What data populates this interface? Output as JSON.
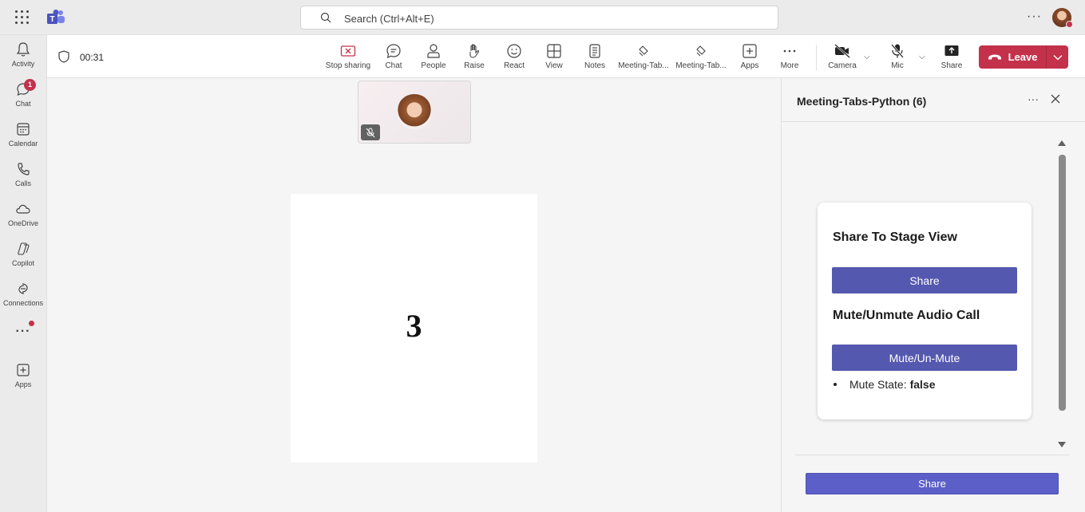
{
  "titlebar": {
    "search_placeholder": "Search (Ctrl+Alt+E)",
    "more": "···"
  },
  "rail": {
    "items": [
      {
        "label": "Activity",
        "icon": "bell-icon"
      },
      {
        "label": "Chat",
        "icon": "chat-icon",
        "badge": "1"
      },
      {
        "label": "Calendar",
        "icon": "calendar-icon"
      },
      {
        "label": "Calls",
        "icon": "phone-icon"
      },
      {
        "label": "OneDrive",
        "icon": "cloud-icon"
      },
      {
        "label": "Copilot",
        "icon": "copilot-icon"
      },
      {
        "label": "Connections",
        "icon": "connections-icon"
      },
      {
        "label": "···",
        "icon": "more-icon"
      },
      {
        "label": "Apps",
        "icon": "apps-icon"
      }
    ]
  },
  "meeting": {
    "timer": "00:31",
    "buttons": [
      {
        "label": "Stop sharing",
        "icon": "stop-sharing-icon"
      },
      {
        "label": "Chat",
        "icon": "chat-icon"
      },
      {
        "label": "People",
        "icon": "people-icon"
      },
      {
        "label": "Raise",
        "icon": "hand-icon"
      },
      {
        "label": "React",
        "icon": "smile-icon"
      },
      {
        "label": "View",
        "icon": "grid-icon"
      },
      {
        "label": "Notes",
        "icon": "notes-icon"
      },
      {
        "label": "Meeting-Tab...",
        "icon": "app-icon"
      },
      {
        "label": "Meeting-Tab...",
        "icon": "app-icon"
      },
      {
        "label": "Apps",
        "icon": "plus-icon"
      },
      {
        "label": "More",
        "icon": "more-icon"
      },
      {
        "label": "Camera",
        "icon": "camera-off-icon"
      },
      {
        "label": "Mic",
        "icon": "mic-off-icon"
      },
      {
        "label": "Share",
        "icon": "share-icon"
      }
    ],
    "leave_label": "Leave"
  },
  "stage": {
    "shared_content": "3"
  },
  "panel": {
    "title": "Meeting-Tabs-Python (6)",
    "card": {
      "heading1": "Share To Stage View",
      "share_button": "Share",
      "heading2": "Mute/Unmute Audio Call",
      "mute_button": "Mute/Un-Mute",
      "state_label": "Mute State:",
      "state_value": "false"
    },
    "footer_button": "Share"
  },
  "colors": {
    "accent": "#5558af",
    "footer_button": "#5b5fc7",
    "leave": "#c4314b",
    "badge": "#c4314b"
  }
}
